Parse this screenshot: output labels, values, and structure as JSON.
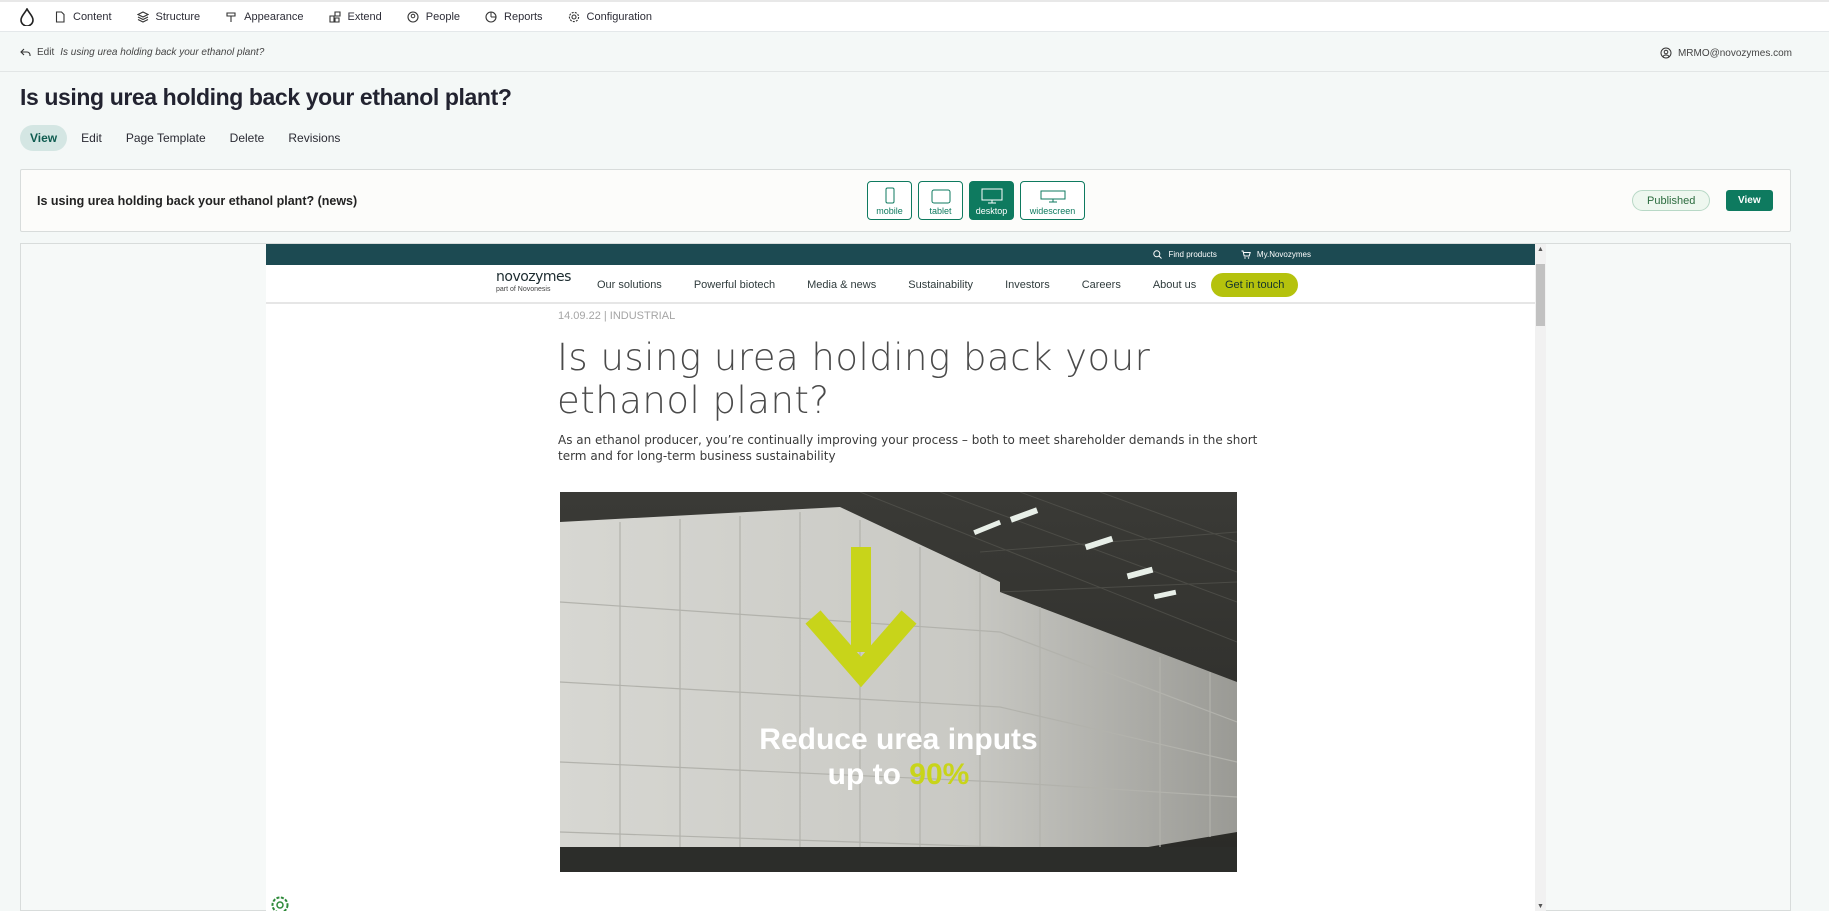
{
  "toolbar": {
    "items": [
      "Content",
      "Structure",
      "Appearance",
      "Extend",
      "People",
      "Reports",
      "Configuration"
    ]
  },
  "breadcrumb": {
    "prefix": "Edit",
    "title": "Is using urea holding back your ethanol plant?"
  },
  "user": {
    "email": "MRMO@novozymes.com"
  },
  "page": {
    "title": "Is using urea holding back your ethanol plant?"
  },
  "tabs": [
    "View",
    "Edit",
    "Page Template",
    "Delete",
    "Revisions"
  ],
  "preview": {
    "title": "Is using urea holding back your ethanol plant? (news)",
    "devices": [
      "mobile",
      "tablet",
      "desktop",
      "widescreen"
    ],
    "active_device": "desktop",
    "status": "Published",
    "view_label": "View"
  },
  "site": {
    "top_links": [
      "Find products",
      "My.Novozymes"
    ],
    "logo": "novozymes",
    "logo_sub": "part of Novonesis",
    "nav": [
      "Our solutions",
      "Powerful biotech",
      "Media & news",
      "Sustainability",
      "Investors",
      "Careers",
      "About us"
    ],
    "cta": "Get in touch"
  },
  "article": {
    "meta": "14.09.22 | INDUSTRIAL",
    "title": "Is using urea holding back your ethanol plant?",
    "lead": "As an ethanol producer, you’re continually improving your process – both to meet shareholder demands in the short term and for long-term business sustainability",
    "hero_line1": "Reduce urea inputs",
    "hero_line2_prefix": "up to ",
    "hero_line2_highlight": "90%"
  },
  "colors": {
    "accent": "#0e7a5f",
    "site_topbar": "#1c4a52",
    "cta": "#b5c20d",
    "highlight": "#c8d41a"
  }
}
